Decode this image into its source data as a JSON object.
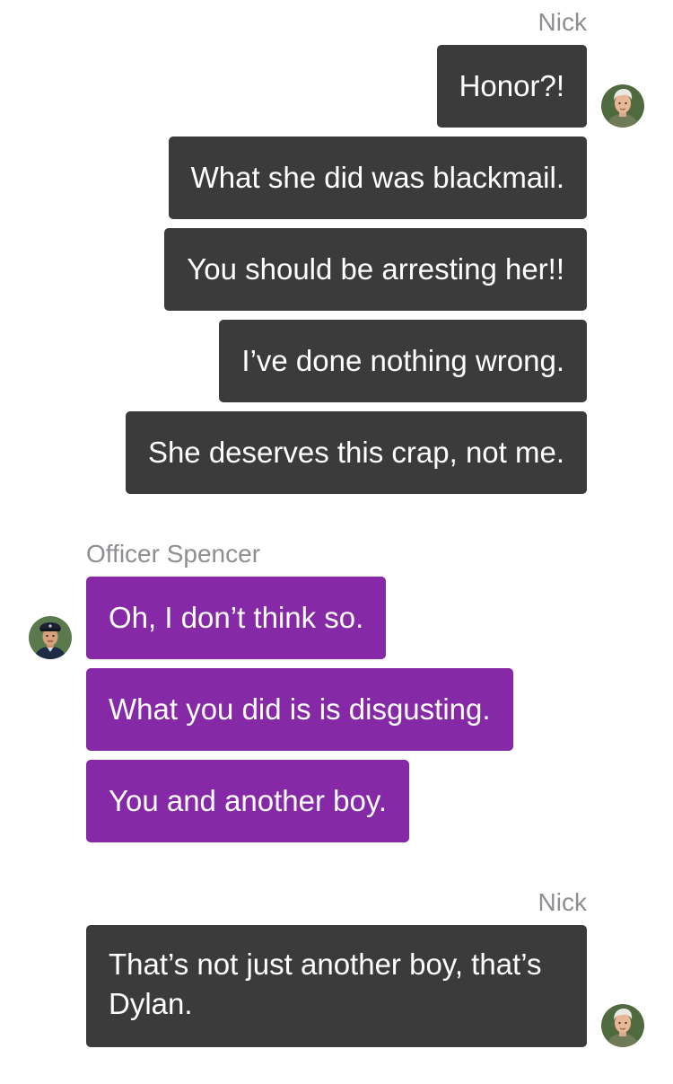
{
  "conversation": {
    "groups": [
      {
        "sender": "Nick",
        "messages": [
          "Honor?!",
          "What she did was blackmail.",
          "You should be arresting her!!",
          "I’ve done nothing wrong.",
          "She deserves this crap, not me."
        ]
      },
      {
        "sender": "Officer Spencer",
        "messages": [
          "Oh, I don’t think so.",
          "What you did is is disgusting.",
          "You and another boy."
        ]
      },
      {
        "sender": "Nick",
        "messages": [
          "That’s not just another boy, that’s Dylan."
        ]
      }
    ]
  },
  "colors": {
    "nick_bubble": "#3b3b3b",
    "spencer_bubble": "#8629a6",
    "sender_name": "#8e8e93",
    "background": "#ffffff"
  },
  "avatars": {
    "nick": "nick-avatar",
    "spencer": "officer-spencer-avatar"
  }
}
